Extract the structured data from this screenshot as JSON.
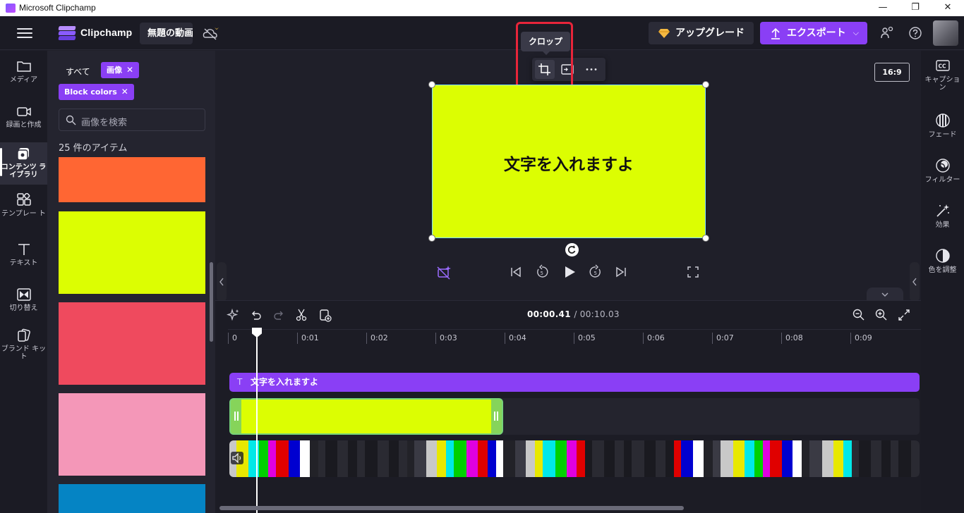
{
  "window": {
    "title": "Microsoft Clipchamp",
    "min": "—",
    "max": "❐",
    "close": "✕"
  },
  "header": {
    "brand": "Clipchamp",
    "project_name": "無題の動画",
    "upgrade_label": "アップグレード",
    "export_label": "エクスポート",
    "export_chevron": "⌵"
  },
  "left_nav": [
    {
      "name": "nav-media",
      "icon": "folder-icon",
      "label": "メディア"
    },
    {
      "name": "nav-record",
      "icon": "video-camera-icon",
      "label": "録画と作成"
    },
    {
      "name": "nav-content-library",
      "icon": "content-library-icon",
      "label": "コンテンツ ライブラリ"
    },
    {
      "name": "nav-templates",
      "icon": "templates-icon",
      "label": "テンプレー ト"
    },
    {
      "name": "nav-text",
      "icon": "text-icon",
      "label": "テキスト"
    },
    {
      "name": "nav-transitions",
      "icon": "transitions-icon",
      "label": "切り替え"
    },
    {
      "name": "nav-brand-kit",
      "icon": "brand-kit-icon",
      "label": "ブランド キッ ト"
    }
  ],
  "panel": {
    "filter_all": "すべて",
    "filter_image": "画像",
    "filter_block": "Block colors",
    "chip_close": "✕",
    "search_placeholder": "画像を検索",
    "item_count": "25 件のアイテム",
    "swatches": [
      "#ff6633",
      "#dcfe02",
      "#ef4a5e",
      "#f497b8",
      "#0584c4"
    ]
  },
  "stage": {
    "tooltip": "クロップ",
    "canvas_text": "文字を入れますよ",
    "aspect_ratio": "16:9",
    "canvas_color": "#dcfe02"
  },
  "right_nav": [
    {
      "name": "rnav-captions",
      "icon": "captions-icon",
      "label": "キャプショ ン"
    },
    {
      "name": "rnav-fade",
      "icon": "fade-icon",
      "label": "フェード"
    },
    {
      "name": "rnav-filters",
      "icon": "filters-icon",
      "label": "フィルター"
    },
    {
      "name": "rnav-effects",
      "icon": "effects-icon",
      "label": "効果"
    },
    {
      "name": "rnav-color",
      "icon": "color-adjust-icon",
      "label": "色を調整"
    }
  ],
  "timeline": {
    "current_time": "00:00.41",
    "total_time": "/ 00:10.03",
    "ticks": [
      "0",
      "0:01",
      "0:02",
      "0:03",
      "0:04",
      "0:05",
      "0:06",
      "0:07",
      "0:08",
      "0:09"
    ],
    "text_track_label": "文字を入れますよ",
    "text_track_icon": "T"
  },
  "colors": {
    "accent": "#8a3ff5",
    "highlight": "#e8253a",
    "lime": "#dcfe02"
  }
}
